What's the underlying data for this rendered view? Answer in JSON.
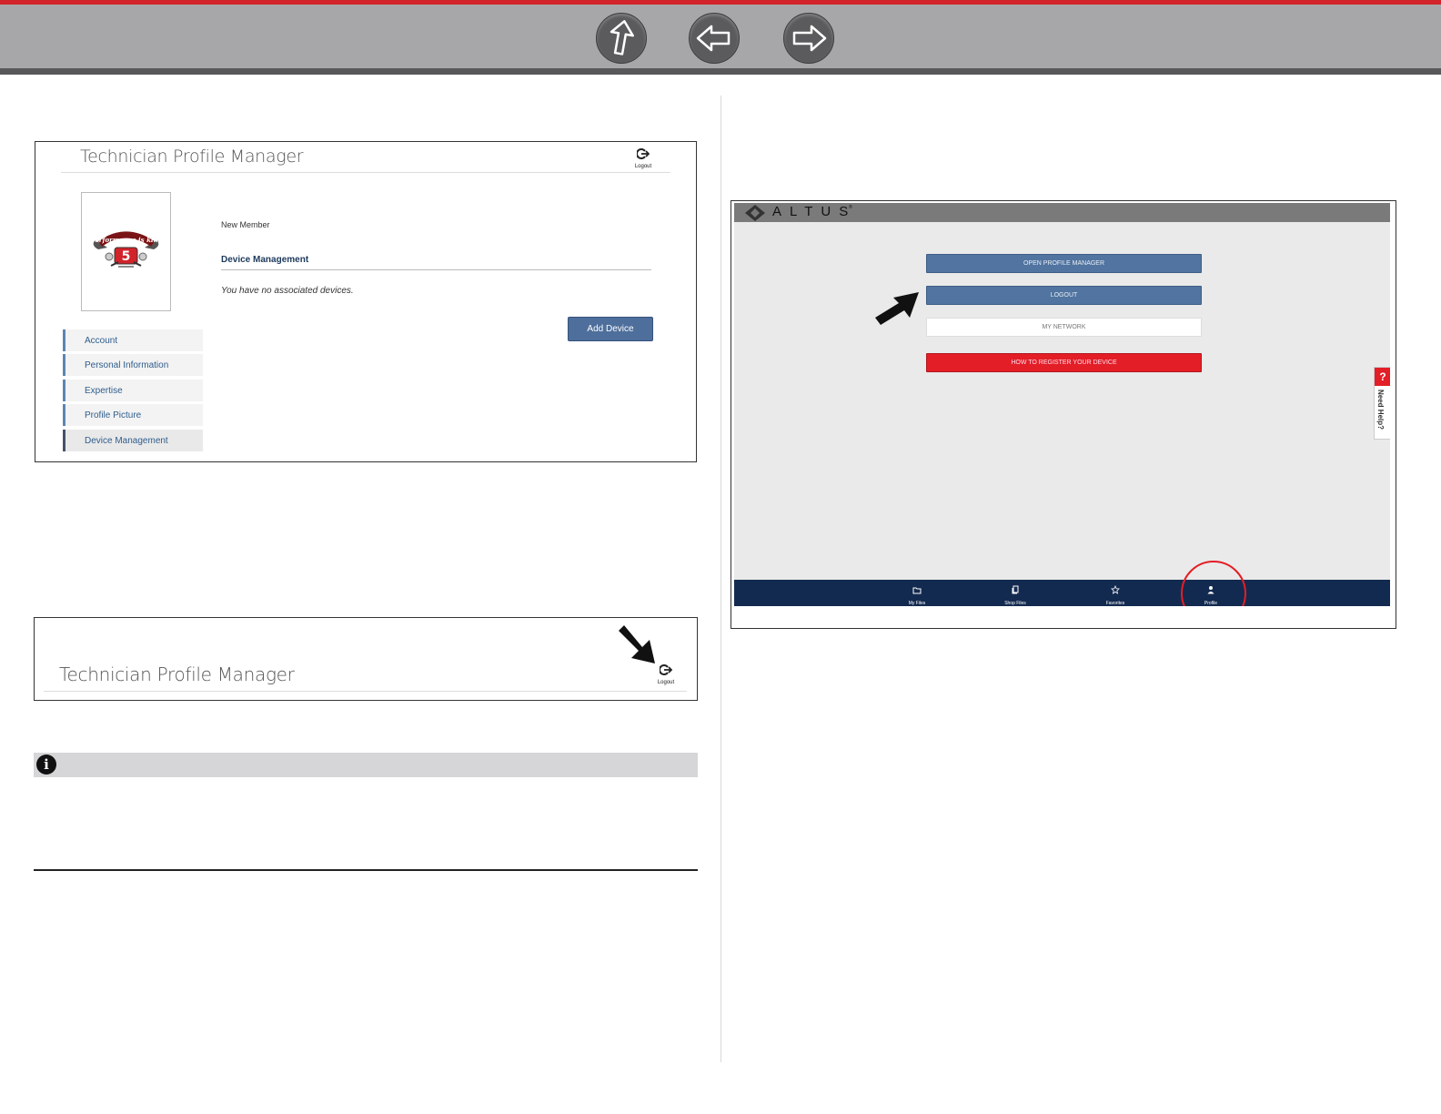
{
  "nav": {
    "up_icon": "up-arrow-icon",
    "back_icon": "back-arrow-icon",
    "forward_icon": "forward-arrow-icon",
    "colors": {
      "red": "#d2232a",
      "bar": "#a7a7a9"
    }
  },
  "profile_manager": {
    "title": "Technician Profile Manager",
    "logout_label": "Logout",
    "member_status": "New Member",
    "section_heading": "Device Management",
    "no_devices_text": "You have no associated devices.",
    "add_device_label": "Add Device",
    "profile_image_text": "performance is king",
    "sidebar": [
      {
        "label": "Account"
      },
      {
        "label": "Personal Information"
      },
      {
        "label": "Expertise"
      },
      {
        "label": "Profile Picture"
      },
      {
        "label": "Device Management"
      }
    ]
  },
  "logout_screenshot": {
    "title": "Technician Profile Manager",
    "logout_label": "Logout"
  },
  "altus": {
    "brand": "ALTUS",
    "brand_mark": "®",
    "buttons": {
      "open_profile_manager": "OPEN PROFILE MANAGER",
      "logout": "LOGOUT",
      "my_network": "MY NETWORK",
      "register": "HOW TO REGISTER YOUR DEVICE"
    },
    "help_label": "Need Help?",
    "help_symbol": "?",
    "tabs": [
      {
        "label": "My Files",
        "icon": "folder-icon"
      },
      {
        "label": "Shop Files",
        "icon": "files-icon"
      },
      {
        "label": "Favorites",
        "icon": "star-icon"
      },
      {
        "label": "Profile",
        "icon": "person-icon"
      }
    ],
    "colors": {
      "blue": "#5174a0",
      "red": "#e31e26",
      "navy": "#132a50"
    }
  }
}
